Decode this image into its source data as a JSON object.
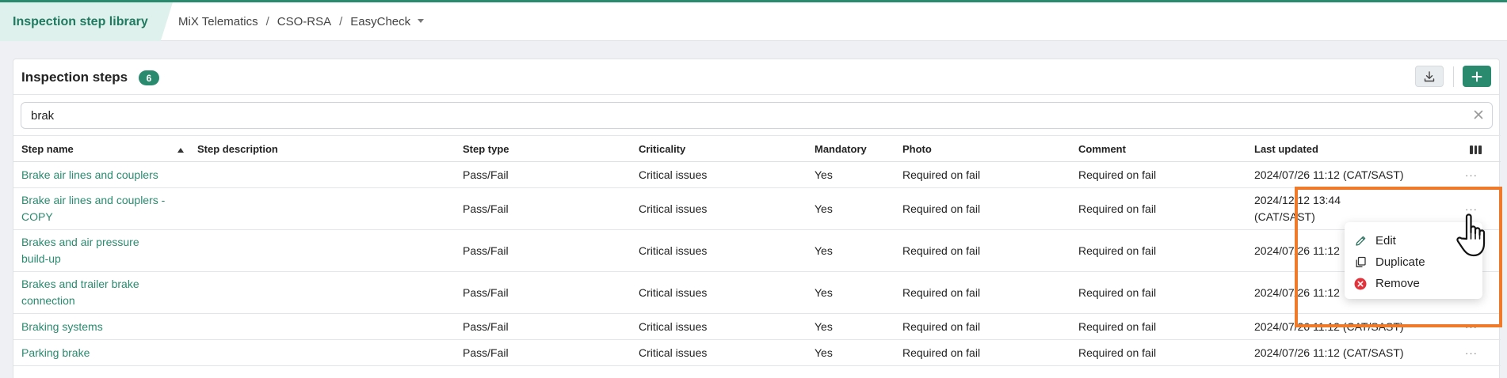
{
  "header": {
    "app_title": "Inspection step library",
    "breadcrumbs": [
      "MiX Telematics",
      "CSO-RSA",
      "EasyCheck"
    ]
  },
  "card": {
    "title": "Inspection steps",
    "count": "6"
  },
  "search": {
    "value": "brak"
  },
  "table": {
    "columns": [
      "Step name",
      "Step description",
      "Step type",
      "Criticality",
      "Mandatory",
      "Photo",
      "Comment",
      "Last updated"
    ],
    "rows": [
      {
        "name": "Brake air lines and couplers",
        "description": "",
        "type": "Pass/Fail",
        "criticality": "Critical issues",
        "mandatory": "Yes",
        "photo": "Required on fail",
        "comment": "Required on fail",
        "updated": "2024/07/26 11:12 (CAT/SAST)"
      },
      {
        "name": "Brake air lines and couplers - COPY",
        "description": "",
        "type": "Pass/Fail",
        "criticality": "Critical issues",
        "mandatory": "Yes",
        "photo": "Required on fail",
        "comment": "Required on fail",
        "updated": "2024/12/12 13:44 (CAT/SAST)"
      },
      {
        "name": "Brakes and air pressure build-up",
        "description": "",
        "type": "Pass/Fail",
        "criticality": "Critical issues",
        "mandatory": "Yes",
        "photo": "Required on fail",
        "comment": "Required on fail",
        "updated": "2024/07/26 11:12"
      },
      {
        "name": "Brakes and trailer brake connection",
        "description": "",
        "type": "Pass/Fail",
        "criticality": "Critical issues",
        "mandatory": "Yes",
        "photo": "Required on fail",
        "comment": "Required on fail",
        "updated": "2024/07/26 11:12"
      },
      {
        "name": "Braking systems",
        "description": "",
        "type": "Pass/Fail",
        "criticality": "Critical issues",
        "mandatory": "Yes",
        "photo": "Required on fail",
        "comment": "Required on fail",
        "updated": "2024/07/26 11:12 (CAT/SAST)"
      },
      {
        "name": "Parking brake",
        "description": "",
        "type": "Pass/Fail",
        "criticality": "Critical issues",
        "mandatory": "Yes",
        "photo": "Required on fail",
        "comment": "Required on fail",
        "updated": "2024/07/26 11:12 (CAT/SAST)"
      }
    ],
    "more_label": "···"
  },
  "context_menu": {
    "items": [
      "Edit",
      "Duplicate",
      "Remove"
    ]
  },
  "colors": {
    "accent": "#2a8a6e",
    "highlight": "#ef7a2a",
    "danger": "#e0343d"
  },
  "icons": [
    "download-icon",
    "plus-icon",
    "clear-icon",
    "columns-icon",
    "more-icon",
    "pencil-icon",
    "duplicate-icon",
    "remove-icon",
    "hand-cursor-icon"
  ]
}
